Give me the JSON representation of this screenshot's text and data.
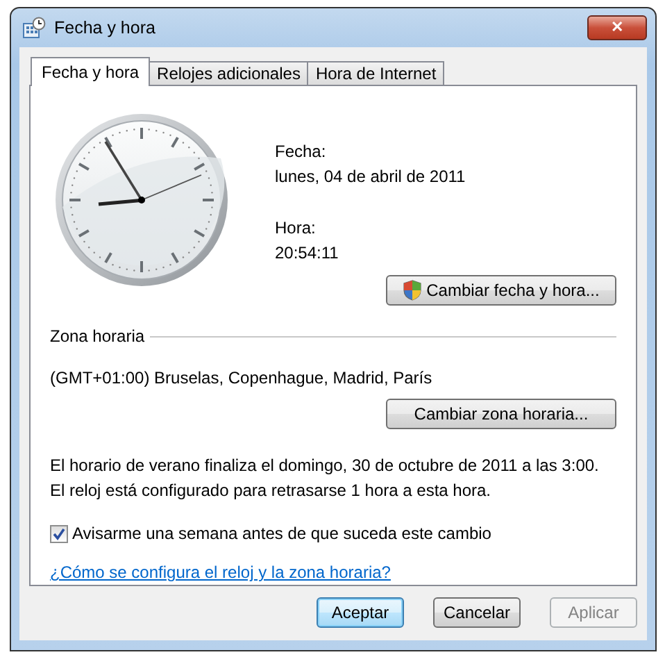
{
  "window": {
    "title": "Fecha y hora",
    "close": "✕"
  },
  "tabs": [
    {
      "label": "Fecha y hora",
      "selected": true
    },
    {
      "label": "Relojes adicionales",
      "selected": false
    },
    {
      "label": "Hora de Internet",
      "selected": false
    }
  ],
  "date": {
    "label": "Fecha:",
    "value": "lunes, 04 de abril de 2011"
  },
  "time": {
    "label": "Hora:",
    "value": "20:54:11"
  },
  "change_datetime_button": "Cambiar fecha y hora...",
  "timezone": {
    "heading": "Zona horaria",
    "value": "(GMT+01:00) Bruselas, Copenhague, Madrid, París",
    "button": "Cambiar zona horaria..."
  },
  "dst_notice": "El horario de verano finaliza el domingo, 30 de octubre de 2011 a las 3:00. El reloj está configurado para retrasarse 1 hora a esta hora.",
  "notify_checkbox": {
    "label": "Avisarme una semana antes de que suceda este cambio",
    "checked": true
  },
  "help_link": "¿Cómo se configura el reloj y la zona horaria?",
  "buttons": [
    {
      "label": "Aceptar",
      "default": true,
      "disabled": false
    },
    {
      "label": "Cancelar",
      "default": false,
      "disabled": false
    },
    {
      "label": "Aplicar",
      "default": false,
      "disabled": true
    }
  ]
}
